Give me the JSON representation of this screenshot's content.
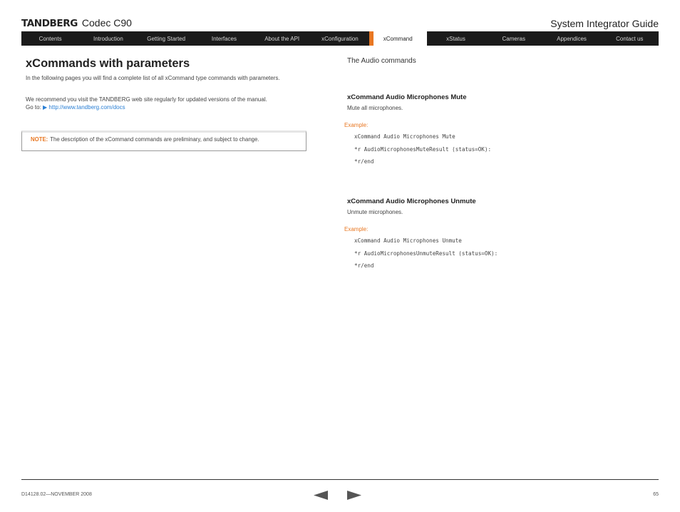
{
  "header": {
    "brand": "TANDBERG",
    "product": "Codec C90",
    "guide_title": "System Integrator Guide"
  },
  "nav": {
    "tabs": [
      {
        "label": "Contents",
        "active": false
      },
      {
        "label": "Introduction",
        "active": false
      },
      {
        "label": "Getting Started",
        "active": false
      },
      {
        "label": "Interfaces",
        "active": false
      },
      {
        "label": "About the API",
        "active": false
      },
      {
        "label": "xConfiguration",
        "active": false
      },
      {
        "label": "xCommand",
        "active": true
      },
      {
        "label": "xStatus",
        "active": false
      },
      {
        "label": "Cameras",
        "active": false
      },
      {
        "label": "Appendices",
        "active": false
      },
      {
        "label": "Contact us",
        "active": false
      }
    ],
    "accent_color": "#e87722"
  },
  "left": {
    "title": "xCommands with parameters",
    "intro": "In the following pages you will find a complete list of all xCommand type commands with parameters.",
    "recommend": "We recommend you visit the TANDBERG web site regularly for updated versions of the manual.",
    "goto_prefix": "Go to:",
    "link_icon": "arrow-right-icon",
    "link_text": "http://www.tandberg.com/docs",
    "link_color": "#2a7fd4",
    "note_label": "NOTE:",
    "note_text": "The description of the xCommand commands are preliminary, and subject to change."
  },
  "right": {
    "section_title": "The Audio commands",
    "commands": [
      {
        "title": "xCommand Audio Microphones Mute",
        "description": "Mute all microphones.",
        "example_label": "Example:",
        "example_lines": [
          "xCommand Audio Microphones Mute",
          "*r AudioMicrophonesMuteResult (status=OK):",
          "*r/end"
        ]
      },
      {
        "title": "xCommand Audio Microphones Unmute",
        "description": "Unmute microphones.",
        "example_label": "Example:",
        "example_lines": [
          "xCommand Audio Microphones Unmute",
          "*r AudioMicrophonesUnmuteResult (status=OK):",
          "*r/end"
        ]
      }
    ]
  },
  "footer": {
    "doc_id": "D14128.02—NOVEMBER 2008",
    "page_number": "65",
    "prev_icon": "triangle-left-icon",
    "next_icon": "triangle-right-icon"
  }
}
